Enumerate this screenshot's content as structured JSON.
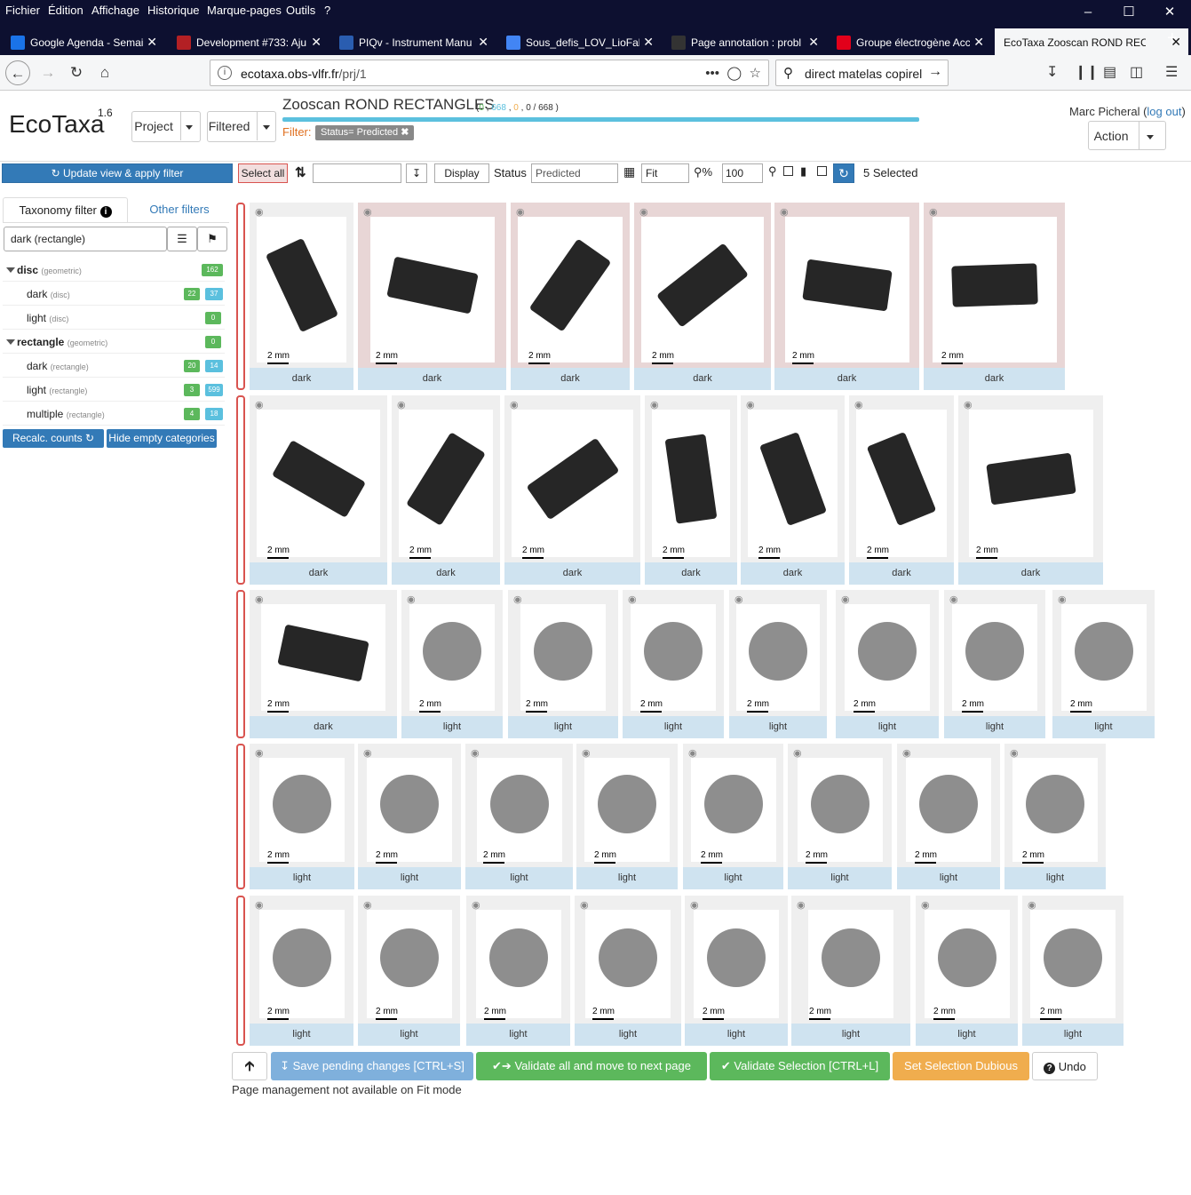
{
  "browser": {
    "menu": [
      "Fichier",
      "Édition",
      "Affichage",
      "Historique",
      "Marque-pages",
      "Outils",
      "?"
    ],
    "tabs": [
      {
        "label": "Google Agenda - Semai",
        "favicon": "calendar-icon",
        "color": "#1a73e8"
      },
      {
        "label": "Development #733: Aju",
        "favicon": "redmine-icon",
        "color": "#b32024"
      },
      {
        "label": "PIQv - Instrument Manu",
        "favicon": "doc-icon",
        "color": "#2a5db0"
      },
      {
        "label": "Sous_defis_LOV_LioFab",
        "favicon": "doc-icon",
        "color": "#4285f4"
      },
      {
        "label": "Page annotation : probl",
        "favicon": "github-icon",
        "color": "#333333"
      },
      {
        "label": "Groupe électrogène Acc",
        "favicon": "shop-icon",
        "color": "#e2001a"
      },
      {
        "label": "EcoTaxa Zooscan ROND REC",
        "favicon": "ecotaxa-icon",
        "color": "#ffffff",
        "active": true
      }
    ],
    "url_domain": "ecotaxa.obs-vlfr.fr",
    "url_path": "/prj/1",
    "search_text": "direct matelas copirel"
  },
  "header": {
    "logo": "EcoTaxa",
    "version": "1.6",
    "project_button": "Project",
    "filtered_button": "Filtered",
    "project_title": "Zooscan ROND RECTANGLES",
    "counts": {
      "a": "0",
      "b": "668",
      "c": "0",
      "d": "0",
      "total": "668"
    },
    "filter_label": "Filter:",
    "filter_tag": "Status= Predicted",
    "user_name": "Marc Picheral",
    "logout": "log out",
    "action_button": "Action"
  },
  "toolbar": {
    "update": "Update view & apply filter",
    "select_all": "Select all",
    "display": "Display",
    "status_label": "Status",
    "status_value": "Predicted",
    "fit": "Fit",
    "zoom_label": "%",
    "zoom_value": "100",
    "selected": "5 Selected"
  },
  "left": {
    "tab_taxo": "Taxonomy filter",
    "tab_other": "Other filters",
    "taxo_select": "dark (rectangle)",
    "tree": [
      {
        "name": "disc",
        "ctx": "(geometric)",
        "level": 0,
        "g": "162",
        "b": ""
      },
      {
        "name": "dark",
        "ctx": "(disc)",
        "level": 1,
        "g": "22",
        "b": "37"
      },
      {
        "name": "light",
        "ctx": "(disc)",
        "level": 1,
        "g": "0",
        "b": ""
      },
      {
        "name": "rectangle",
        "ctx": "(geometric)",
        "level": 0,
        "g": "0",
        "b": ""
      },
      {
        "name": "dark",
        "ctx": "(rectangle)",
        "level": 1,
        "g": "20",
        "b": "14"
      },
      {
        "name": "light",
        "ctx": "(rectangle)",
        "level": 1,
        "g": "3",
        "b": "599"
      },
      {
        "name": "multiple",
        "ctx": "(rectangle)",
        "level": 1,
        "g": "4",
        "b": "18"
      }
    ],
    "recalc": "Recalc. counts",
    "hide_empty": "Hide empty categories"
  },
  "scale_label": "2 mm",
  "grid": [
    [
      {
        "label": "dark",
        "selected": false,
        "shape": "rect",
        "angle": 65
      },
      {
        "label": "dark",
        "selected": true,
        "shape": "rect",
        "angle": 12
      },
      {
        "label": "dark",
        "selected": true,
        "shape": "rect",
        "angle": -55
      },
      {
        "label": "dark",
        "selected": true,
        "shape": "rect",
        "angle": -38
      },
      {
        "label": "dark",
        "selected": true,
        "shape": "rect",
        "angle": 8
      },
      {
        "label": "dark",
        "selected": true,
        "shape": "rect",
        "angle": -2
      }
    ],
    [
      {
        "label": "dark",
        "selected": false,
        "shape": "rect",
        "angle": 30
      },
      {
        "label": "dark",
        "selected": false,
        "shape": "rect",
        "angle": -58
      },
      {
        "label": "dark",
        "selected": false,
        "shape": "rect",
        "angle": -35
      },
      {
        "label": "dark",
        "selected": false,
        "shape": "rect",
        "angle": 82
      },
      {
        "label": "dark",
        "selected": false,
        "shape": "rect",
        "angle": 70
      },
      {
        "label": "dark",
        "selected": false,
        "shape": "rect",
        "angle": 68
      },
      {
        "label": "dark",
        "selected": false,
        "shape": "rect",
        "angle": -8
      }
    ],
    [
      {
        "label": "dark",
        "selected": false,
        "shape": "rect",
        "angle": 12
      },
      {
        "label": "light",
        "selected": false,
        "shape": "disc"
      },
      {
        "label": "light",
        "selected": false,
        "shape": "disc"
      },
      {
        "label": "light",
        "selected": false,
        "shape": "disc"
      },
      {
        "label": "light",
        "selected": false,
        "shape": "disc"
      },
      {
        "label": "light",
        "selected": false,
        "shape": "disc"
      },
      {
        "label": "light",
        "selected": false,
        "shape": "disc"
      },
      {
        "label": "light",
        "selected": false,
        "shape": "disc"
      }
    ],
    [
      {
        "label": "light",
        "selected": false,
        "shape": "disc"
      },
      {
        "label": "light",
        "selected": false,
        "shape": "disc"
      },
      {
        "label": "light",
        "selected": false,
        "shape": "disc"
      },
      {
        "label": "light",
        "selected": false,
        "shape": "disc"
      },
      {
        "label": "light",
        "selected": false,
        "shape": "disc"
      },
      {
        "label": "light",
        "selected": false,
        "shape": "disc"
      },
      {
        "label": "light",
        "selected": false,
        "shape": "disc"
      },
      {
        "label": "light",
        "selected": false,
        "shape": "disc"
      }
    ],
    [
      {
        "label": "light",
        "selected": false,
        "shape": "disc"
      },
      {
        "label": "light",
        "selected": false,
        "shape": "disc"
      },
      {
        "label": "light",
        "selected": false,
        "shape": "disc"
      },
      {
        "label": "light",
        "selected": false,
        "shape": "disc"
      },
      {
        "label": "light",
        "selected": false,
        "shape": "disc"
      },
      {
        "label": "light",
        "selected": false,
        "shape": "disc"
      },
      {
        "label": "light",
        "selected": false,
        "shape": "disc"
      },
      {
        "label": "light",
        "selected": false,
        "shape": "disc"
      }
    ]
  ],
  "bottom": {
    "save": "Save pending changes [CTRL+S]",
    "validate_all": "Validate all and move to next page",
    "validate_sel": "Validate Selection [CTRL+L]",
    "dubious": "Set Selection Dubious",
    "undo": "Undo",
    "note": "Page management not available on Fit mode"
  },
  "colors": {
    "primary": "#337ab7",
    "success": "#5cb85c",
    "warning": "#f0ad4e",
    "info": "#5bc0de",
    "danger": "#d9534f"
  }
}
